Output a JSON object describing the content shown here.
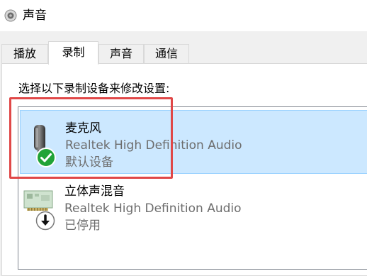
{
  "window": {
    "title": "声音",
    "icon": "speaker-icon"
  },
  "tabs": [
    {
      "label": "播放",
      "active": false
    },
    {
      "label": "录制",
      "active": true
    },
    {
      "label": "声音",
      "active": false
    },
    {
      "label": "通信",
      "active": false
    }
  ],
  "recording": {
    "instruction": "选择以下录制设备来修改设置:",
    "devices": [
      {
        "name": "麦克风",
        "driver": "Realtek High Definition Audio",
        "status": "默认设备",
        "icon": "microphone-icon",
        "badge": "default-check-icon",
        "selected": true
      },
      {
        "name": "立体声混音",
        "driver": "Realtek High Definition Audio",
        "status": "已停用",
        "icon": "sound-card-icon",
        "badge": "disabled-arrow-icon",
        "selected": false
      }
    ]
  },
  "colors": {
    "selection_bg": "#cce8ff",
    "selection_border": "#99d1ff",
    "highlight": "#e04848",
    "check_green": "#21a336"
  }
}
